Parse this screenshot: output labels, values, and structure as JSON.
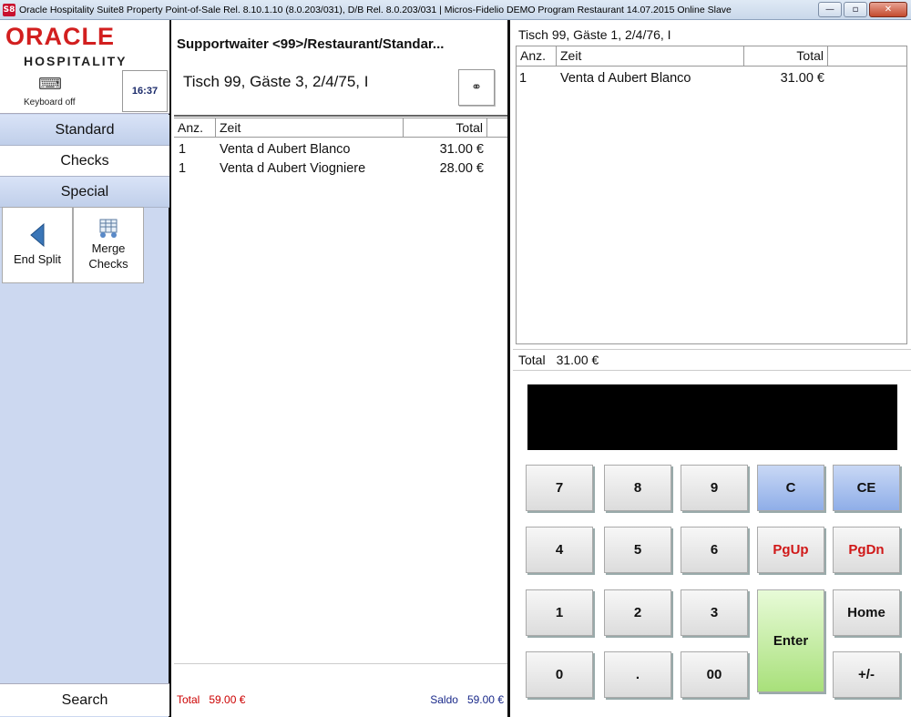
{
  "window": {
    "title": "Oracle Hospitality Suite8 Property Point-of-Sale Rel. 8.10.1.10 (8.0.203/031), D/B Rel. 8.0.203/031 | Micros-Fidelio DEMO Program Restaurant 14.07.2015 Online Slave",
    "app_icon_text": "S8",
    "min": "—",
    "max": "▫",
    "close": "✕"
  },
  "left": {
    "logo_oracle": "ORACLE",
    "logo_hospitality": "HOSPITALITY",
    "keyboard_label": "Keyboard off",
    "keyboard_icon": "⌨",
    "clock": "16:37",
    "tabs": [
      "Standard",
      "Checks",
      "Special"
    ],
    "end_split_label": "End Split",
    "merge_checks_label": "Merge Checks",
    "search_label": "Search"
  },
  "middle": {
    "title": "Supportwaiter <99>/Restaurant/Standar...",
    "table_label": "Tisch 99, Gäste 3, 2/4/75, I",
    "split_icon": "⚭",
    "columns": {
      "qty": "Anz.",
      "time": "Zeit",
      "total": "Total"
    },
    "rows": [
      {
        "qty": "1",
        "item": "Venta d Aubert Blanco",
        "total": "31.00 €"
      },
      {
        "qty": "1",
        "item": "Venta d Aubert Viogniere",
        "total": "28.00 €"
      }
    ],
    "total_label": "Total",
    "total_value": "59.00 €",
    "saldo_label": "Saldo",
    "saldo_value": "59.00 €"
  },
  "right": {
    "title": "Tisch 99, Gäste 1, 2/4/76, I",
    "columns": {
      "qty": "Anz.",
      "time": "Zeit",
      "total": "Total"
    },
    "rows": [
      {
        "qty": "1",
        "item": "Venta d Aubert Blanco",
        "total": "31.00 €"
      }
    ],
    "total_label": "Total",
    "total_value": "31.00 €"
  },
  "keypad": {
    "k7": "7",
    "k8": "8",
    "k9": "9",
    "kC": "C",
    "kCE": "CE",
    "k4": "4",
    "k5": "5",
    "k6": "6",
    "kPgUp": "PgUp",
    "kPgDn": "PgDn",
    "k1": "1",
    "k2": "2",
    "k3": "3",
    "kEnter": "Enter",
    "kHome": "Home",
    "k0": "0",
    "kDot": ".",
    "k00": "00",
    "kPlusMinus": "+/-"
  }
}
